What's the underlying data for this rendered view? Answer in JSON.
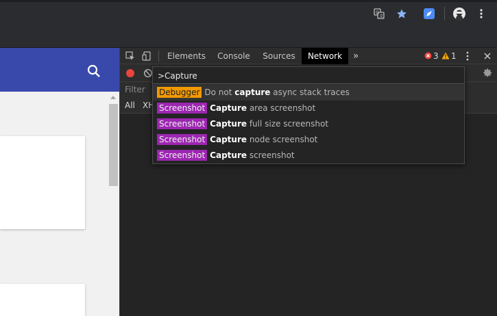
{
  "browser": {
    "icons": [
      "translate-icon",
      "star-icon",
      "extension-icon",
      "profile-icon",
      "menu-kebab-icon"
    ],
    "accent": "#8ab4f8"
  },
  "page": {
    "appbar_color": "#3949ab",
    "search_icon": "search-icon"
  },
  "devtools": {
    "tabs": [
      {
        "label": "Elements"
      },
      {
        "label": "Console"
      },
      {
        "label": "Sources"
      },
      {
        "label": "Network"
      }
    ],
    "active_tab": "Network",
    "more_tabs": "»",
    "errors": "3",
    "warnings": "1",
    "filter_placeholder": "Filter",
    "type_all": "All",
    "type_xhr": "XH"
  },
  "command_menu": {
    "query": ">Capture",
    "items": [
      {
        "badge": "Debugger",
        "badge_color": "#f29900",
        "pre": "Do not ",
        "bold": "capture",
        "post": " async stack traces"
      },
      {
        "badge": "Screenshot",
        "badge_color": "#9c27b0",
        "pre": "",
        "bold": "Capture",
        "post": " area screenshot"
      },
      {
        "badge": "Screenshot",
        "badge_color": "#9c27b0",
        "pre": "",
        "bold": "Capture",
        "post": " full size screenshot"
      },
      {
        "badge": "Screenshot",
        "badge_color": "#9c27b0",
        "pre": "",
        "bold": "Capture",
        "post": " node screenshot"
      },
      {
        "badge": "Screenshot",
        "badge_color": "#9c27b0",
        "pre": "",
        "bold": "Capture",
        "post": " screenshot"
      }
    ]
  }
}
